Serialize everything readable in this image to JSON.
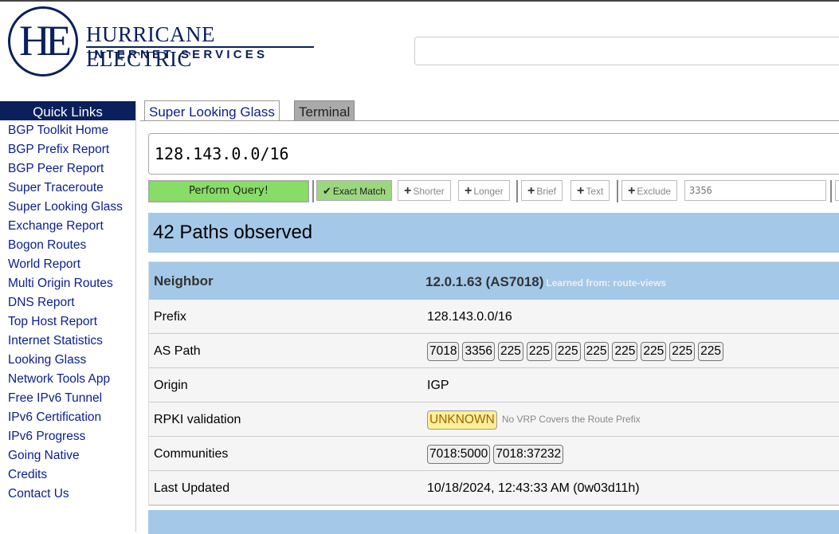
{
  "logo": {
    "mark": "HE",
    "line1": "HURRICANE ELECTRIC",
    "line2": "INTERNET SERVICES"
  },
  "sidebar": {
    "title": "Quick Links",
    "items": [
      {
        "label": "BGP Toolkit Home"
      },
      {
        "label": "BGP Prefix Report"
      },
      {
        "label": "BGP Peer Report"
      },
      {
        "label": "Super Traceroute"
      },
      {
        "label": "Super Looking Glass"
      },
      {
        "label": "Exchange Report"
      },
      {
        "label": "Bogon Routes"
      },
      {
        "label": "World Report"
      },
      {
        "label": "Multi Origin Routes"
      },
      {
        "label": "DNS Report"
      },
      {
        "label": "Top Host Report"
      },
      {
        "label": "Internet Statistics"
      },
      {
        "label": "Looking Glass"
      },
      {
        "label": "Network Tools App"
      },
      {
        "label": "Free IPv6 Tunnel"
      },
      {
        "label": "IPv6 Certification"
      },
      {
        "label": "IPv6 Progress"
      },
      {
        "label": "Going Native"
      },
      {
        "label": "Credits"
      },
      {
        "label": "Contact Us"
      }
    ]
  },
  "tabs": [
    {
      "label": "Super Looking Glass",
      "active": true
    },
    {
      "label": "Terminal",
      "active": false
    }
  ],
  "query": {
    "value": "128.143.0.0/16",
    "perform_label": "Perform Query!",
    "options": {
      "exact": "Exact Match",
      "shorter": "Shorter",
      "longer": "Longer",
      "brief": "Brief",
      "text": "Text",
      "exclude": "Exclude"
    },
    "exclude_value": "3356"
  },
  "results": {
    "paths_observed": "42 Paths observed",
    "neighbor": {
      "header_label": "Neighbor",
      "header_value": "12.0.1.63 (AS7018)",
      "learned_from": "Learned from: route-views",
      "prefix_label": "Prefix",
      "prefix_value": "128.143.0.0/16",
      "as_path_label": "AS Path",
      "as_path": [
        "7018",
        "3356",
        "225",
        "225",
        "225",
        "225",
        "225",
        "225",
        "225",
        "225"
      ],
      "origin_label": "Origin",
      "origin_value": "IGP",
      "rpki_label": "RPKI validation",
      "rpki_status": "UNKNOWN",
      "rpki_note": "No VRP Covers the Route Prefix",
      "communities_label": "Communities",
      "communities": [
        "7018:5000",
        "7018:37232"
      ],
      "updated_label": "Last Updated",
      "updated_value": "10/18/2024, 12:43:33 AM (0w03d11h)"
    }
  },
  "colors": {
    "brand_navy": "#0a1f5c",
    "link_blue": "#0a1f8c",
    "header_blue": "#a4c8e8",
    "perform_green": "#88dd66",
    "unknown_yellow": "#ffef9a"
  }
}
